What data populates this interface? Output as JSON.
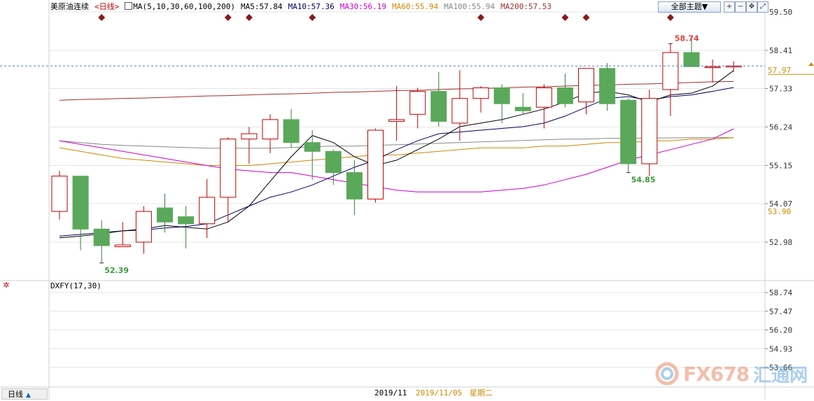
{
  "header": {
    "title": "美原油连续",
    "period": "<日线>",
    "ma_params": "MA(5,10,30,60,100,200)",
    "ma5": "MA5:57.84",
    "ma10": "MA10:57.36",
    "ma30": "MA30:56.19",
    "ma60": "MA60:55.94",
    "ma100": "MA100:55.94",
    "ma200": "MA200:57.53",
    "topic_button": "全部主题▼",
    "toolbar_icons": [
      "zoom-in-icon",
      "zoom-out-icon",
      "move-icon",
      "expand-icon"
    ]
  },
  "colors": {
    "up": "#c00000",
    "down": "#5aa85a",
    "ma5": "#000000",
    "ma10": "#000066",
    "ma30": "#cc00cc",
    "ma60": "#cc8800",
    "ma100": "#888888",
    "ma200": "#a03030",
    "last_price": "#cc8800",
    "grid": "#e6e6e6"
  },
  "sub_chart": {
    "title": "DXFY(17,30)"
  },
  "footer": {
    "period_tab": "日线",
    "month": "2019/11",
    "date": "2019/11/05",
    "weekday": "星期二"
  },
  "watermark": {
    "text1": "FX678",
    "text2": "汇通网"
  },
  "chart_data": [
    {
      "type": "candlestick",
      "title": "美原油连续",
      "y_axis_ticks": [
        "59.50",
        "58.41",
        "57.33",
        "56.24",
        "55.15",
        "54.07",
        "52.98"
      ],
      "ylim": [
        52.4,
        59.6
      ],
      "last_price_label": "57.97",
      "ma60_label": "53.90",
      "annotations": [
        {
          "label": "58.74",
          "kind": "high",
          "index": 29
        },
        {
          "label": "54.85",
          "kind": "low",
          "index": 27
        },
        {
          "label": "52.39",
          "kind": "low",
          "index": 2
        }
      ],
      "event_marker_indices": [
        2,
        8,
        9,
        12,
        20,
        24,
        25,
        29
      ],
      "candles": [
        {
          "o": 53.85,
          "h": 55.0,
          "l": 53.62,
          "c": 54.85
        },
        {
          "o": 54.85,
          "h": 54.85,
          "l": 52.75,
          "c": 53.35
        },
        {
          "o": 53.35,
          "h": 53.6,
          "l": 52.39,
          "c": 52.88
        },
        {
          "o": 52.85,
          "h": 53.55,
          "l": 52.85,
          "c": 52.9
        },
        {
          "o": 52.98,
          "h": 54.0,
          "l": 52.65,
          "c": 53.85
        },
        {
          "o": 53.95,
          "h": 54.35,
          "l": 53.25,
          "c": 53.55
        },
        {
          "o": 53.7,
          "h": 54.0,
          "l": 52.8,
          "c": 53.5
        },
        {
          "o": 53.5,
          "h": 54.77,
          "l": 53.1,
          "c": 54.25
        },
        {
          "o": 54.25,
          "h": 55.95,
          "l": 53.55,
          "c": 55.9
        },
        {
          "o": 55.9,
          "h": 56.24,
          "l": 55.2,
          "c": 56.05
        },
        {
          "o": 55.9,
          "h": 56.6,
          "l": 55.5,
          "c": 56.45
        },
        {
          "o": 56.45,
          "h": 56.75,
          "l": 55.65,
          "c": 55.8
        },
        {
          "o": 55.8,
          "h": 56.15,
          "l": 54.75,
          "c": 55.55
        },
        {
          "o": 55.55,
          "h": 55.6,
          "l": 54.6,
          "c": 54.95
        },
        {
          "o": 54.95,
          "h": 55.3,
          "l": 53.75,
          "c": 54.2
        },
        {
          "o": 54.2,
          "h": 56.2,
          "l": 54.1,
          "c": 56.15
        },
        {
          "o": 56.4,
          "h": 57.4,
          "l": 55.85,
          "c": 56.45
        },
        {
          "o": 56.6,
          "h": 57.35,
          "l": 56.2,
          "c": 57.25
        },
        {
          "o": 57.25,
          "h": 57.8,
          "l": 56.25,
          "c": 56.4
        },
        {
          "o": 56.35,
          "h": 57.85,
          "l": 55.85,
          "c": 57.05
        },
        {
          "o": 57.05,
          "h": 57.4,
          "l": 56.65,
          "c": 57.35
        },
        {
          "o": 57.35,
          "h": 57.45,
          "l": 56.35,
          "c": 56.9
        },
        {
          "o": 56.8,
          "h": 57.2,
          "l": 56.6,
          "c": 56.7
        },
        {
          "o": 56.8,
          "h": 57.45,
          "l": 56.2,
          "c": 57.35
        },
        {
          "o": 57.35,
          "h": 57.75,
          "l": 56.8,
          "c": 56.9
        },
        {
          "o": 56.95,
          "h": 57.85,
          "l": 56.6,
          "c": 57.9
        },
        {
          "o": 57.9,
          "h": 58.05,
          "l": 56.7,
          "c": 56.9
        },
        {
          "o": 57.0,
          "h": 57.05,
          "l": 54.95,
          "c": 55.2
        },
        {
          "o": 55.2,
          "h": 57.3,
          "l": 54.85,
          "c": 57.05
        },
        {
          "o": 57.3,
          "h": 58.6,
          "l": 56.55,
          "c": 58.35
        },
        {
          "o": 58.35,
          "h": 58.74,
          "l": 57.95,
          "c": 57.95
        },
        {
          "o": 57.95,
          "h": 58.15,
          "l": 57.5,
          "c": 57.95
        },
        {
          "o": 57.97,
          "h": 58.1,
          "l": 57.8,
          "c": 57.97
        }
      ],
      "ma": {
        "ma5": [
          53.1,
          53.15,
          53.22,
          53.3,
          53.35,
          53.45,
          53.4,
          53.35,
          53.55,
          54.0,
          54.7,
          55.4,
          56.0,
          55.8,
          55.4,
          55.15,
          55.3,
          55.6,
          55.9,
          56.25,
          56.35,
          56.45,
          56.6,
          56.75,
          56.95,
          57.2,
          57.25,
          57.15,
          56.95,
          57.15,
          57.2,
          57.4,
          57.84
        ],
        "ma10": [
          53.15,
          53.2,
          53.25,
          53.3,
          53.32,
          53.38,
          53.42,
          53.5,
          53.75,
          54.0,
          54.25,
          54.4,
          54.6,
          54.85,
          55.1,
          55.3,
          55.6,
          55.85,
          56.05,
          56.1,
          56.15,
          56.2,
          56.25,
          56.35,
          56.55,
          56.8,
          57.05,
          57.1,
          57.0,
          57.1,
          57.15,
          57.25,
          57.36
        ],
        "ma30": [
          55.85,
          55.75,
          55.65,
          55.55,
          55.45,
          55.35,
          55.25,
          55.15,
          55.05,
          55.0,
          54.95,
          54.95,
          54.85,
          54.75,
          54.65,
          54.55,
          54.45,
          54.4,
          54.4,
          54.4,
          54.4,
          54.45,
          54.5,
          54.6,
          54.75,
          54.9,
          55.1,
          55.3,
          55.45,
          55.6,
          55.75,
          55.9,
          56.19
        ],
        "ma60": [
          55.65,
          55.55,
          55.45,
          55.35,
          55.3,
          55.25,
          55.2,
          55.15,
          55.15,
          55.15,
          55.2,
          55.25,
          55.3,
          55.35,
          55.4,
          55.45,
          55.45,
          55.5,
          55.55,
          55.6,
          55.65,
          55.65,
          55.65,
          55.7,
          55.7,
          55.75,
          55.8,
          55.8,
          55.85,
          55.85,
          55.9,
          55.9,
          55.94
        ],
        "ma100": [
          55.85,
          55.8,
          55.75,
          55.72,
          55.7,
          55.68,
          55.66,
          55.64,
          55.64,
          55.64,
          55.64,
          55.66,
          55.68,
          55.7,
          55.7,
          55.72,
          55.74,
          55.76,
          55.78,
          55.8,
          55.82,
          55.84,
          55.86,
          55.88,
          55.9,
          55.9,
          55.92,
          55.92,
          55.93,
          55.93,
          55.94,
          55.94,
          55.94
        ],
        "ma200": [
          57.0,
          57.02,
          57.03,
          57.05,
          57.06,
          57.08,
          57.1,
          57.12,
          57.13,
          57.15,
          57.17,
          57.18,
          57.2,
          57.22,
          57.23,
          57.25,
          57.27,
          57.28,
          57.3,
          57.32,
          57.33,
          57.35,
          57.37,
          57.38,
          57.4,
          57.42,
          57.43,
          57.45,
          57.46,
          57.48,
          57.5,
          57.52,
          57.53
        ]
      }
    },
    {
      "type": "line",
      "title": "DXFY(17,30)",
      "y_axis_ticks": [
        "58.74",
        "57.47",
        "56.20",
        "54.93",
        "53.66"
      ],
      "ylim": [
        53.2,
        59.2
      ],
      "series": []
    }
  ]
}
